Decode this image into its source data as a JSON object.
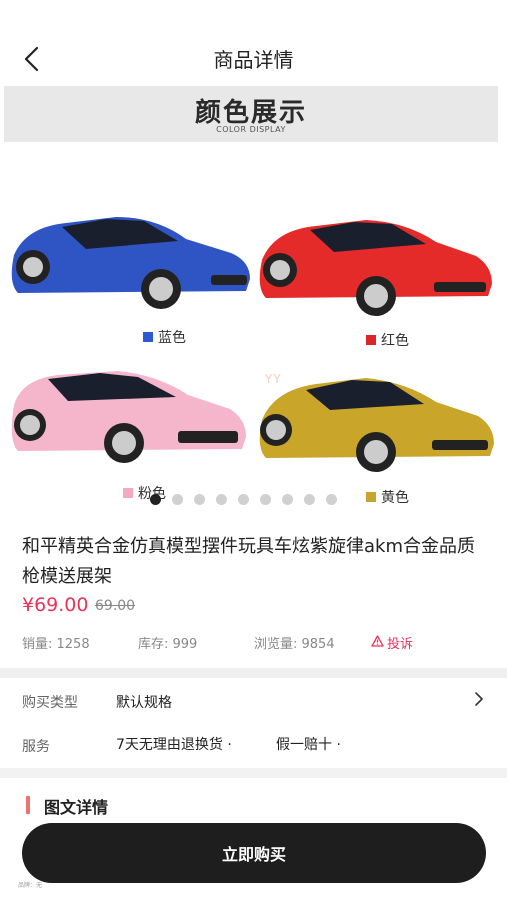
{
  "header": {
    "title": "商品详情"
  },
  "banner": {
    "title": "颜色展示",
    "subtitle": "COLOR DISPLAY",
    "watermark": "YY",
    "colors": [
      {
        "label": "蓝色",
        "swatch": "#2a5bd0",
        "car": "#2f55c4"
      },
      {
        "label": "红色",
        "swatch": "#d8262a",
        "car": "#e52a2a"
      },
      {
        "label": "粉色",
        "swatch": "#f4a9c2",
        "car": "#f5b6cb"
      },
      {
        "label": "黄色",
        "swatch": "#c9a230",
        "car": "#c9a52a"
      }
    ],
    "dots_total": 9,
    "dots_active": 1
  },
  "product": {
    "title": "和平精英合金仿真模型摆件玩具车炫紫旋律akm合金品质枪模送展架",
    "price": "¥69.00",
    "original_price": "69.00",
    "sales": "销量: 1258",
    "stock": "库存: 999",
    "views": "浏览量: 9854",
    "complain": "投诉"
  },
  "options": {
    "type_label": "购买类型",
    "type_value": "默认规格",
    "service_label": "服务",
    "service_1": "7天无理由退换货 ·",
    "service_2": "假一赔十 ·"
  },
  "detail": {
    "title": "图文详情",
    "note": "品牌：无"
  },
  "buy_button": "立即购买",
  "accent_color": "#e8345a"
}
